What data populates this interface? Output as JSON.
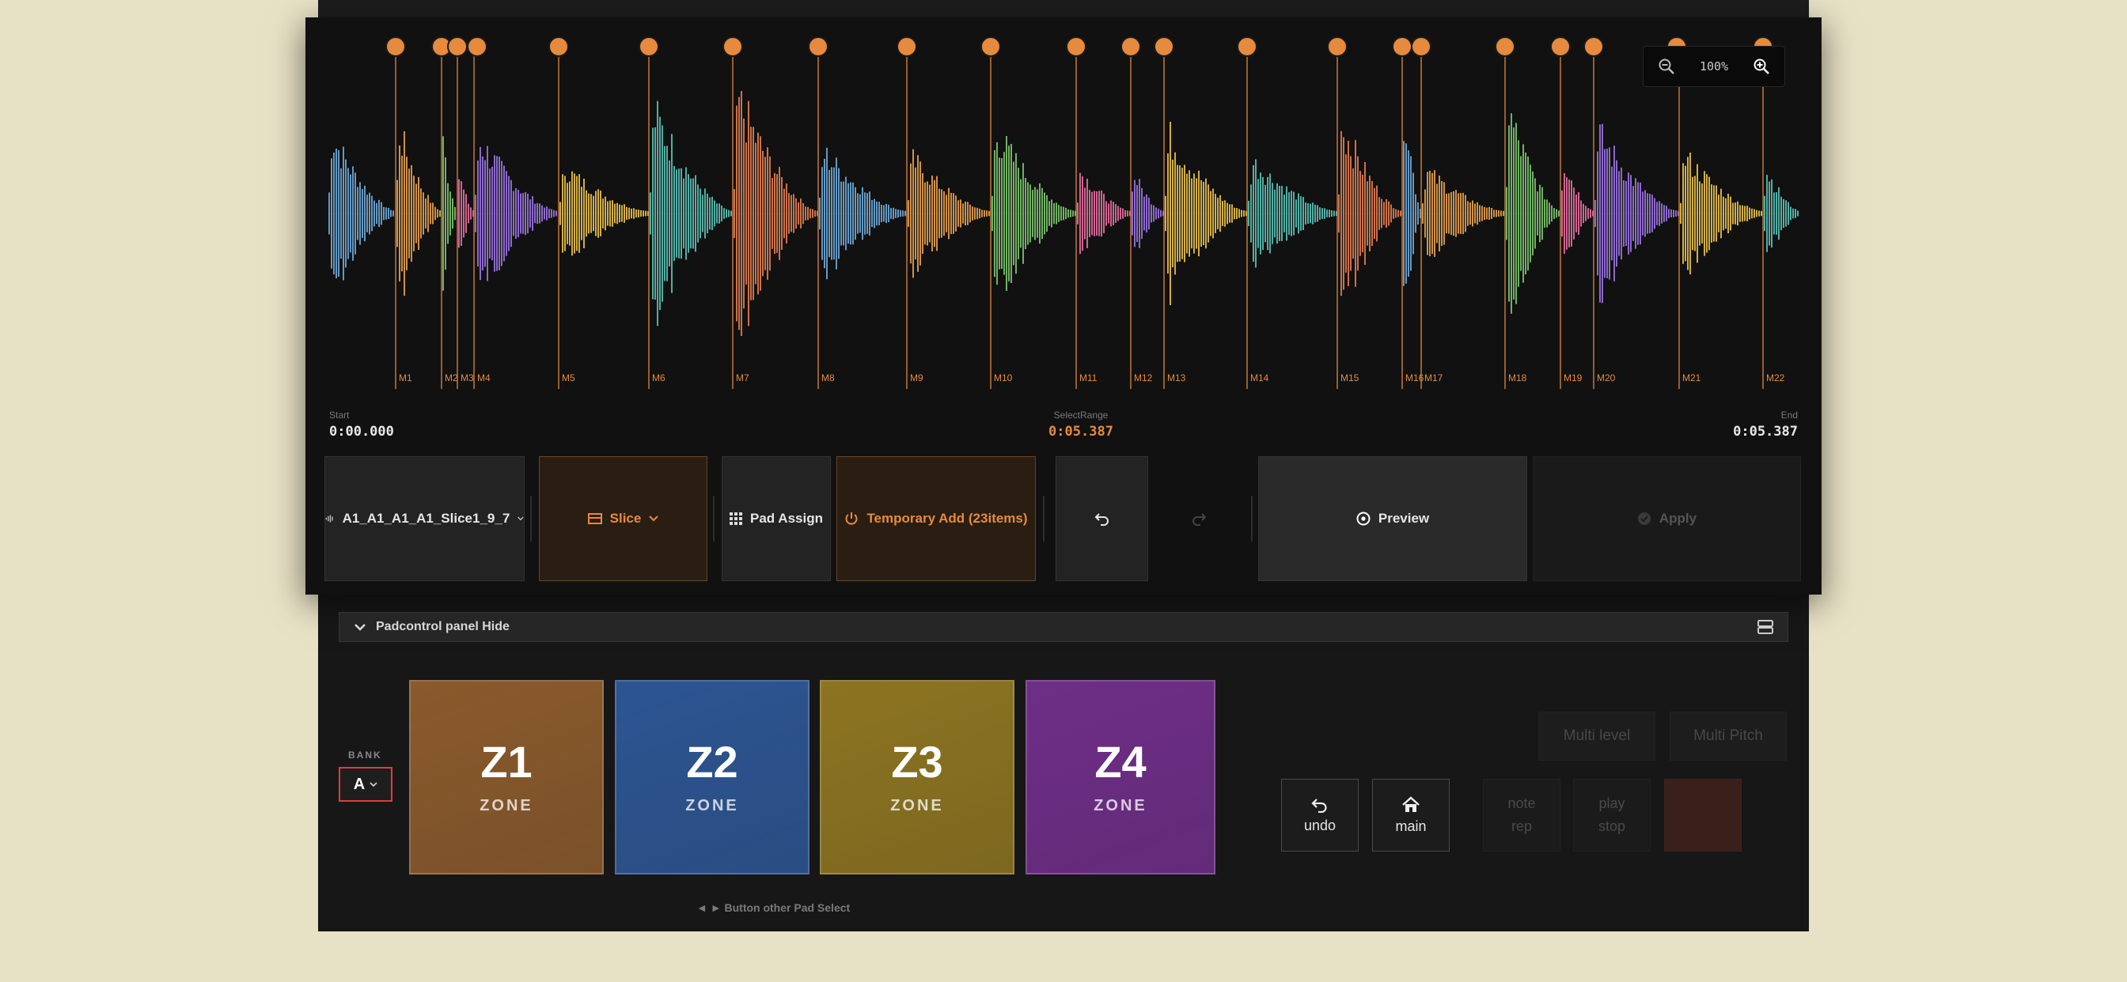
{
  "waveform": {
    "markers": [
      "M1",
      "M2",
      "M3",
      "M4",
      "M5",
      "M6",
      "M7",
      "M8",
      "M9",
      "M10",
      "M11",
      "M12",
      "M13",
      "M14",
      "M15",
      "M16",
      "M17",
      "M18",
      "M19",
      "M20",
      "M21",
      "M22"
    ]
  },
  "zoom": {
    "level": "100%"
  },
  "range": {
    "start_label": "Start",
    "start_value": "0:00.000",
    "select_label": "SelectRange",
    "select_value": "0:05.387",
    "end_label": "End",
    "end_value": "0:05.387"
  },
  "toolbar": {
    "sample_name": "A1_A1_A1_A1_Slice1_9_7",
    "slice_label": "Slice",
    "pad_assign_label": "Pad Assign",
    "temporary_add_label": "Temporary Add (23items)",
    "preview_label": "Preview",
    "apply_label": "Apply"
  },
  "padcontrol": {
    "toggle_label": "Padcontrol panel Hide",
    "bank_label": "BANK",
    "bank_value": "A",
    "zones": [
      {
        "title": "Z1",
        "sub": "ZONE",
        "color": "#8a5a2c"
      },
      {
        "title": "Z2",
        "sub": "ZONE",
        "color": "#2d5592"
      },
      {
        "title": "Z3",
        "sub": "ZONE",
        "color": "#8c7421"
      },
      {
        "title": "Z4",
        "sub": "ZONE",
        "color": "#6e2e87"
      }
    ],
    "hint": "◄ ► Button other Pad Select",
    "undo_label": "undo",
    "main_label": "main",
    "note_rep_line1": "note",
    "note_rep_line2": "rep",
    "play_stop_line1": "play",
    "play_stop_line2": "stop",
    "multi_level_label": "Multi level",
    "multi_pitch_label": "Multi Pitch"
  },
  "colors": {
    "accent": "#e68a3e",
    "bank_outline": "#e23b3b",
    "wave_palette": [
      "#6fa9d6",
      "#e6a04c",
      "#7bc46e",
      "#e46fa0",
      "#9a73e0",
      "#e8c04a",
      "#5bc0b4",
      "#e07d52"
    ]
  }
}
